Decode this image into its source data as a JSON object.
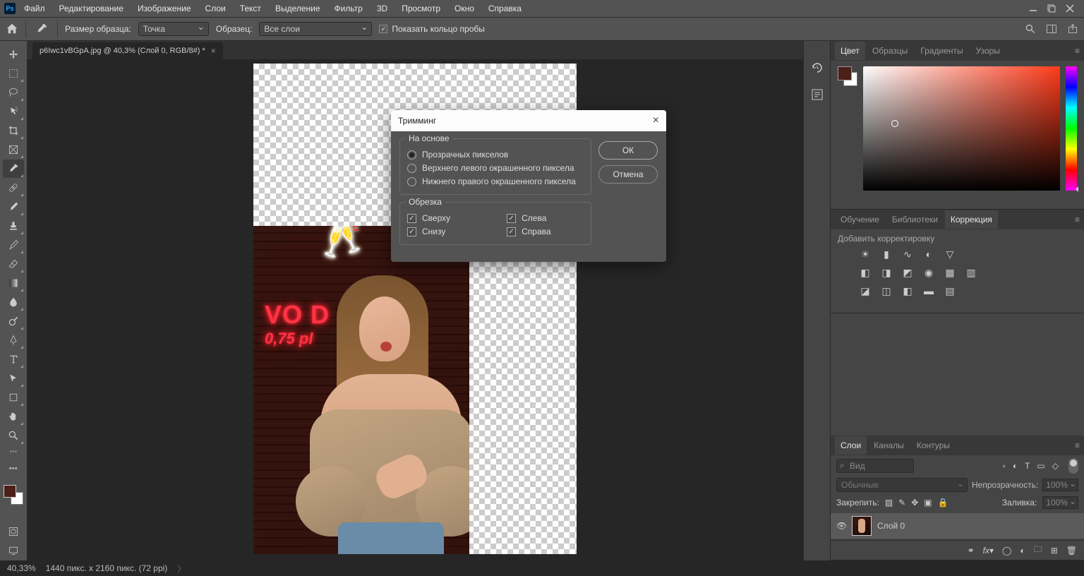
{
  "menubar": {
    "items": [
      "Файл",
      "Редактирование",
      "Изображение",
      "Слои",
      "Текст",
      "Выделение",
      "Фильтр",
      "3D",
      "Просмотр",
      "Окно",
      "Справка"
    ]
  },
  "optionsbar": {
    "sample_size_label": "Размер образца:",
    "sample_size_value": "Точка",
    "sample_label": "Образец:",
    "sample_value": "Все слои",
    "show_ring": "Показать кольцо пробы"
  },
  "doc_tab": "p6Iwc1vBGpA.jpg @ 40,3% (Слой 0, RGB/8#) *",
  "neon": {
    "line1": "VO D",
    "line2": "0,75 pl"
  },
  "statusbar": {
    "zoom": "40,33%",
    "dims": "1440 пикс. x 2160 пикс. (72 ppi)"
  },
  "dialog": {
    "title": "Тримминг",
    "group1": "На основе",
    "opt_transparent": "Прозрачных пикселов",
    "opt_topleft": "Верхнего левого окрашенного пиксела",
    "opt_bottomright": "Нижнего правого окрашенного пиксела",
    "group2": "Обрезка",
    "top": "Сверху",
    "bottom": "Снизу",
    "left": "Слева",
    "right": "Справа",
    "ok": "ОК",
    "cancel": "Отмена"
  },
  "color_tabs": [
    "Цвет",
    "Образцы",
    "Градиенты",
    "Узоры"
  ],
  "adj_tabs": [
    "Обучение",
    "Библиотеки",
    "Коррекция"
  ],
  "adj_label": "Добавить корректировку",
  "layers_tabs": [
    "Слои",
    "Каналы",
    "Контуры"
  ],
  "layers": {
    "search_placeholder": "Вид",
    "blend_mode": "Обычные",
    "opacity_label": "Непрозрачность:",
    "opacity_value": "100%",
    "lock_label": "Закрепить:",
    "fill_label": "Заливка:",
    "fill_value": "100%",
    "layer0": "Слой 0"
  }
}
